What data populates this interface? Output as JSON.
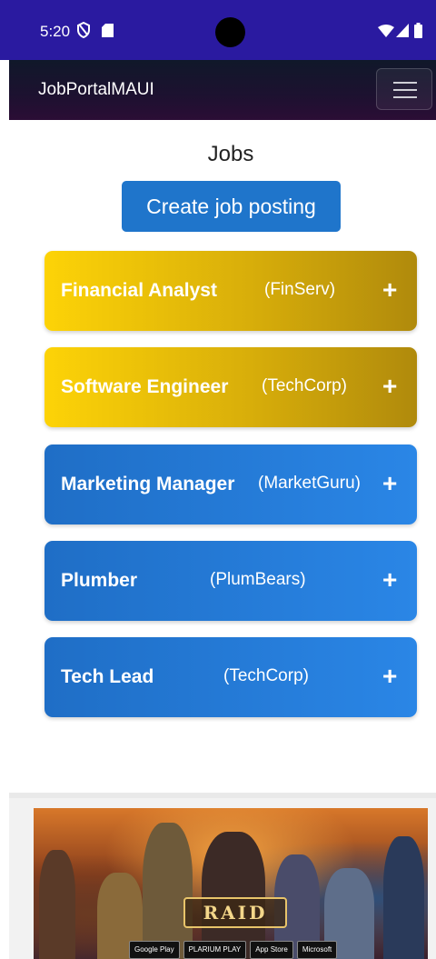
{
  "status_bar": {
    "time": "5:20"
  },
  "navbar": {
    "brand": "JobPortalMAUI"
  },
  "page": {
    "title": "Jobs",
    "create_button": "Create job posting"
  },
  "jobs": [
    {
      "title": "Financial Analyst",
      "company": "(FinServ)",
      "color": "#fdd307",
      "action": "+"
    },
    {
      "title": "Software Engineer",
      "company": "(TechCorp)",
      "color": "#fdd307",
      "action": "+"
    },
    {
      "title": "Marketing Manager",
      "company": "(MarketGuru)",
      "color": "#1f6ec6",
      "action": "+"
    },
    {
      "title": "Plumber",
      "company": "(PlumBears)",
      "color": "#1f6ec6",
      "action": "+"
    },
    {
      "title": "Tech Lead",
      "company": "(TechCorp)",
      "color": "#1f6ec6",
      "action": "+"
    }
  ],
  "ad": {
    "logo": "RAID",
    "badges": [
      "Google Play",
      "PLARIUM PLAY",
      "App Store",
      "Microsoft"
    ]
  },
  "colors": {
    "status_bar": "#2a1aa0",
    "primary": "#1f75cb",
    "gold": "#fdd307",
    "blue": "#2a86e6"
  }
}
